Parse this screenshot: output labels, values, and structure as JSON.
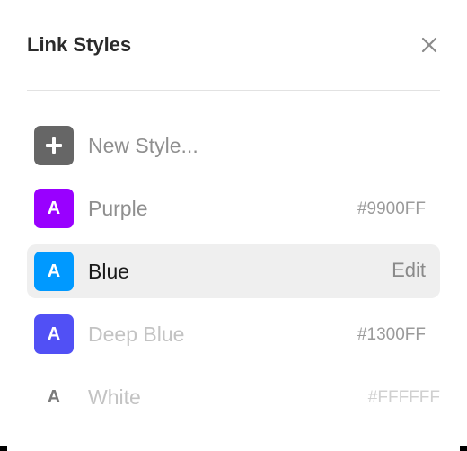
{
  "panel": {
    "title": "Link Styles"
  },
  "new_style": {
    "label": "New Style...",
    "icon": "plus-icon",
    "swatch_color": "#666666"
  },
  "styles": [
    {
      "name": "Purple",
      "swatch_letter": "A",
      "value": "#9900FF",
      "swatch_color": "#9900FF"
    },
    {
      "name": "Blue",
      "swatch_letter": "A",
      "value": "Edit",
      "swatch_color": "#0099FF",
      "selected": true
    },
    {
      "name": "Deep Blue",
      "swatch_letter": "A",
      "value": "#1300FF",
      "swatch_color": "#5150F5"
    },
    {
      "name": "White",
      "swatch_letter": "A",
      "value": "#FFFFFF",
      "swatch_color": "#FFFFFF"
    }
  ],
  "colors": {
    "selected_row_bg": "#EFEFEF",
    "divider": "#E2E2E2"
  }
}
